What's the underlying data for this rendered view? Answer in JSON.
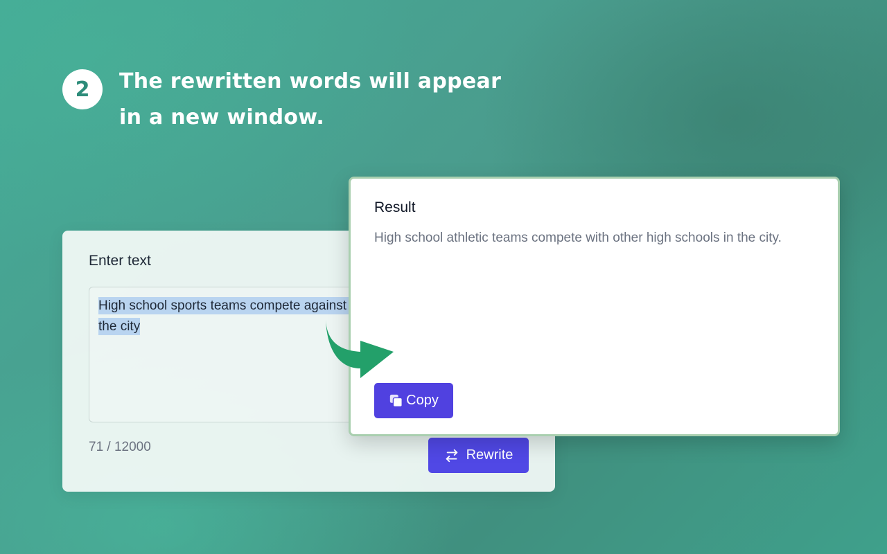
{
  "step": {
    "number": "2",
    "lines": [
      "The rewritten words will appear",
      "in a new window."
    ]
  },
  "input_card": {
    "title": "Enter text",
    "text": "High school sports teams compete against other high schools in the city",
    "char_count": "71 / 12000",
    "rewrite_label": "Rewrite",
    "rewrite_icon": "swap-arrows-icon"
  },
  "result_card": {
    "title": "Result",
    "text": "High school athletic teams compete with other high schools in the city.",
    "copy_label": "Copy",
    "copy_icon": "copy-icon"
  },
  "colors": {
    "button": "#5048e5",
    "arrow": "#23a06a",
    "result_border": "#a9cfaf"
  }
}
